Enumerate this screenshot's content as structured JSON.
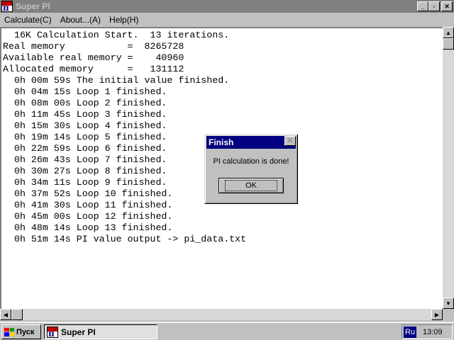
{
  "window": {
    "title": "Super PI",
    "icon": "superpi-app-icon",
    "icon_text": "π",
    "controls": {
      "minimize": "_",
      "maximize": "▫",
      "close": "✕"
    }
  },
  "menu": {
    "items": [
      {
        "label": "Calculate(C)"
      },
      {
        "label": "About...(A)"
      },
      {
        "label": "Help(H)"
      }
    ]
  },
  "console": {
    "lines": [
      "  16K Calculation Start.  13 iterations.",
      "Real memory           =  8265728",
      "Available real memory =    40960",
      "Allocated memory      =   131112",
      "  0h 00m 59s The initial value finished.",
      "  0h 04m 15s Loop 1 finished.",
      "  0h 08m 00s Loop 2 finished.",
      "  0h 11m 45s Loop 3 finished.",
      "  0h 15m 30s Loop 4 finished.",
      "  0h 19m 14s Loop 5 finished.",
      "  0h 22m 59s Loop 6 finished.",
      "  0h 26m 43s Loop 7 finished.",
      "  0h 30m 27s Loop 8 finished.",
      "  0h 34m 11s Loop 9 finished.",
      "  0h 37m 52s Loop 10 finished.",
      "  0h 41m 30s Loop 11 finished.",
      "  0h 45m 00s Loop 12 finished.",
      "  0h 48m 14s Loop 13 finished.",
      "  0h 51m 14s PI value output -> pi_data.txt"
    ]
  },
  "scrollbars": {
    "up": "▲",
    "down": "▼",
    "left": "◀",
    "right": "▶"
  },
  "dialog": {
    "title": "Finish",
    "close_glyph": "✕",
    "message": "PI calculation is done!",
    "ok_label": "OK"
  },
  "taskbar": {
    "start_label": "Пуск",
    "task_label": "Super PI",
    "language": "Ru",
    "clock": "13:09"
  },
  "colors": {
    "title_inactive": "#808080",
    "dialog_title_active": "#000080",
    "face": "#c0c0c0",
    "desktop": "#008080"
  }
}
